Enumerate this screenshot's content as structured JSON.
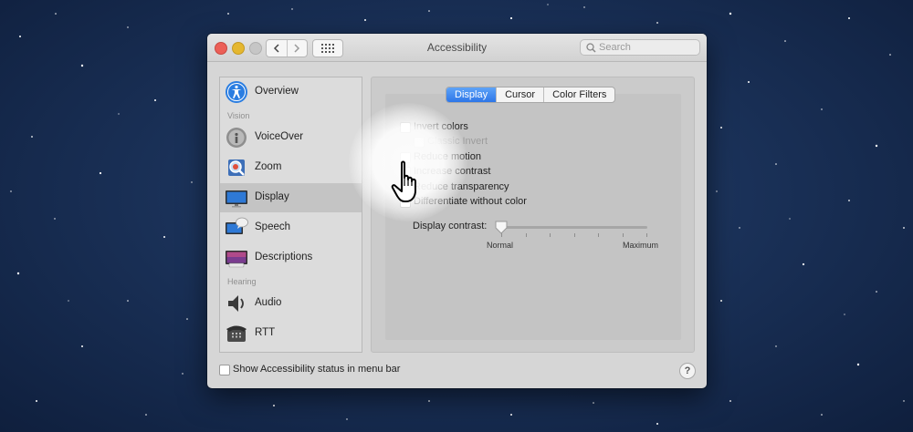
{
  "window": {
    "title": "Accessibility",
    "search_placeholder": "Search"
  },
  "sidebar": {
    "items": [
      {
        "label": "Overview",
        "icon": "accessibility-icon"
      },
      {
        "label": "VoiceOver",
        "icon": "voiceover-icon"
      },
      {
        "label": "Zoom",
        "icon": "zoom-icon"
      },
      {
        "label": "Display",
        "icon": "display-icon",
        "selected": true
      },
      {
        "label": "Speech",
        "icon": "speech-icon"
      },
      {
        "label": "Descriptions",
        "icon": "descriptions-icon"
      },
      {
        "label": "Audio",
        "icon": "speaker-icon"
      },
      {
        "label": "RTT",
        "icon": "telephone-icon"
      }
    ],
    "sections": {
      "vision": "Vision",
      "hearing": "Hearing"
    }
  },
  "tabs": [
    {
      "label": "Display",
      "active": true
    },
    {
      "label": "Cursor",
      "active": false
    },
    {
      "label": "Color Filters",
      "active": false
    }
  ],
  "options": [
    {
      "label": "Invert colors",
      "checked": false,
      "enabled": true
    },
    {
      "label": "Classic Invert",
      "checked": false,
      "enabled": false
    },
    {
      "label": "Reduce motion",
      "checked": false,
      "enabled": true
    },
    {
      "label": "Increase contrast",
      "checked": false,
      "enabled": true
    },
    {
      "label": "Reduce transparency",
      "checked": false,
      "enabled": true
    },
    {
      "label": "Differentiate without color",
      "checked": false,
      "enabled": true
    }
  ],
  "contrast": {
    "label": "Display contrast:",
    "min_label": "Normal",
    "max_label": "Maximum",
    "value": 0
  },
  "footer": {
    "status_menu_label": "Show Accessibility status in menu bar",
    "status_menu_checked": false,
    "help_label": "?"
  },
  "colors": {
    "accent": "#2d76e8",
    "close": "#ec5f57",
    "minimize": "#e5b72f",
    "window_bg": "#d6d6d6"
  }
}
